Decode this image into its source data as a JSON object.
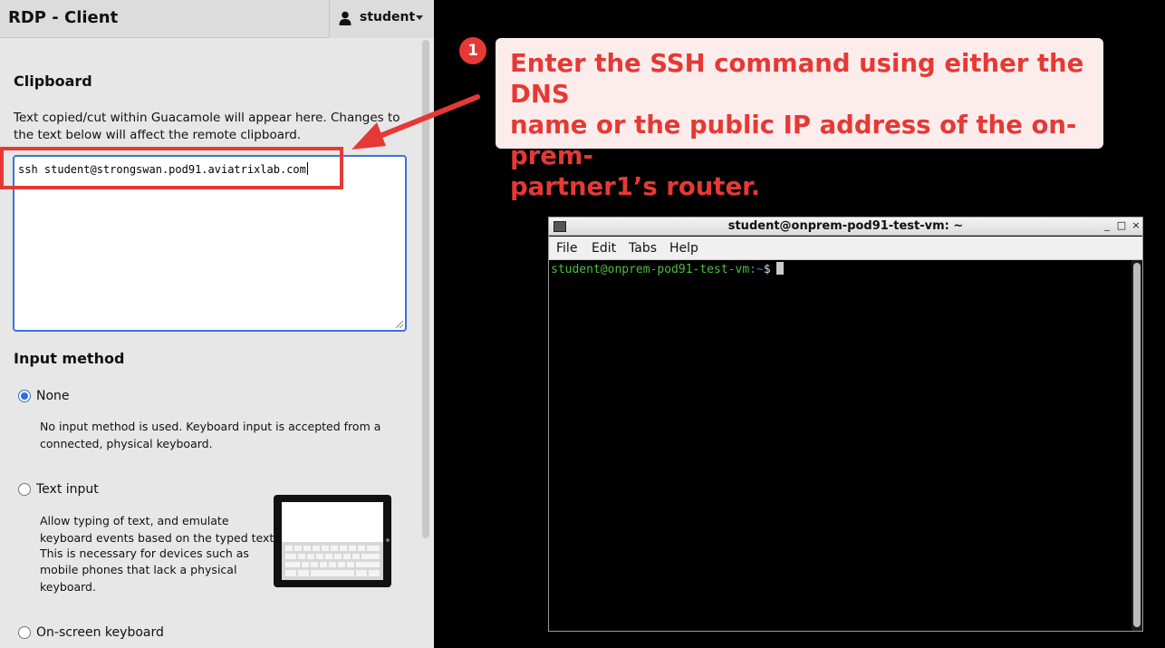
{
  "app": {
    "title": "RDP - Client",
    "user": "student"
  },
  "clipboard": {
    "heading": "Clipboard",
    "description_line1": "Text copied/cut within Guacamole will appear here. Changes to",
    "description_line2": "the text below will affect the remote clipboard.",
    "value": "ssh student@strongswan.pod91.aviatrixlab.com"
  },
  "input_method": {
    "heading": "Input method",
    "options": [
      {
        "label": "None",
        "selected": true,
        "desc_lines": [
          "No input method is used. Keyboard input is accepted from a",
          "connected, physical keyboard."
        ]
      },
      {
        "label": "Text input",
        "selected": false,
        "desc_lines": [
          "Allow typing of text, and emulate",
          "keyboard events based on the typed text.",
          "This is necessary for devices such as",
          "mobile phones that lack a physical",
          "keyboard."
        ]
      },
      {
        "label": "On-screen keyboard",
        "selected": false
      }
    ]
  },
  "annotation": {
    "step": "1",
    "line1": "Enter the SSH command using either the DNS",
    "line2": "name or the public IP address of the on-prem-",
    "line3": "partner1’s router.",
    "color": "#e53935"
  },
  "terminal": {
    "title": "student@onprem-pod91-test-vm: ~",
    "window_controls": [
      "_",
      "□",
      "×"
    ],
    "menu": [
      "File",
      "Edit",
      "Tabs",
      "Help"
    ],
    "prompt_user": "student@onprem-pod91-test-vm",
    "prompt_sep": ":~",
    "prompt_symbol": "$"
  }
}
